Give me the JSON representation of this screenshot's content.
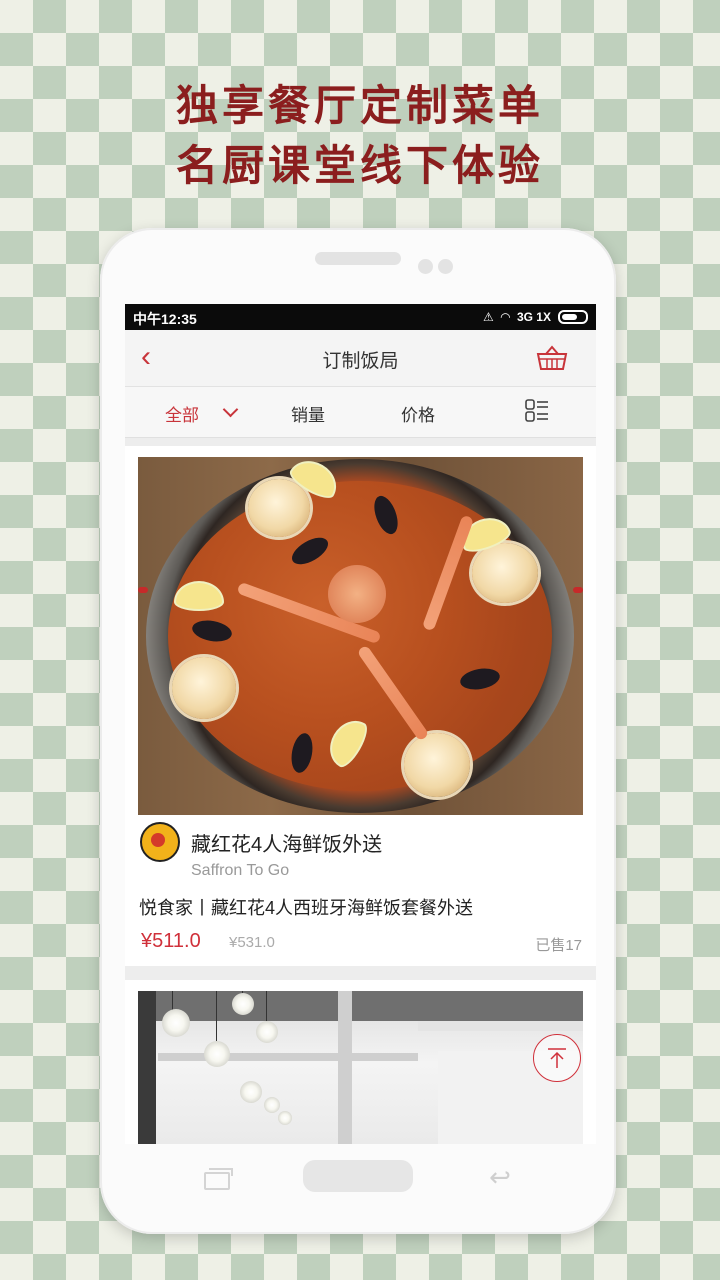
{
  "promo": {
    "line1": "独享餐厅定制菜单",
    "line2": "名厨课堂线下体验"
  },
  "statusbar": {
    "time": "中午12:35",
    "network": "3G 1X"
  },
  "header": {
    "title": "订制饭局"
  },
  "filters": {
    "all": "全部",
    "sales": "销量",
    "price": "价格"
  },
  "listing": {
    "dish_name": "藏红花4人海鲜饭外送",
    "shop_name": "Saffron To Go",
    "description": "悦食家丨藏红花4人西班牙海鲜饭套餐外送",
    "price": "¥511.0",
    "original_price": "¥531.0",
    "sold": "已售17"
  },
  "colors": {
    "accent": "#c8343a",
    "headline": "#8b1e1e",
    "checker": "#bfd0bd"
  },
  "icons": [
    "back-arrow-icon",
    "basket-icon",
    "chevron-down-icon",
    "list-view-icon",
    "scroll-top-icon"
  ]
}
